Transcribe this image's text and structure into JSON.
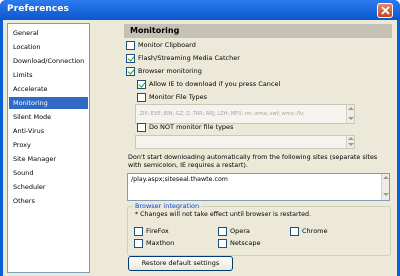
{
  "window": {
    "title": "Preferences"
  },
  "sidebar": {
    "items": [
      {
        "label": "General"
      },
      {
        "label": "Location"
      },
      {
        "label": "Download/Connection"
      },
      {
        "label": "Limits"
      },
      {
        "label": "Accelerate"
      },
      {
        "label": "Monitoring",
        "selected": true
      },
      {
        "label": "Silent Mode"
      },
      {
        "label": "Anti-Virus"
      },
      {
        "label": "Proxy"
      },
      {
        "label": "Site Manager"
      },
      {
        "label": "Sound"
      },
      {
        "label": "Scheduler"
      },
      {
        "label": "Others"
      }
    ]
  },
  "panel": {
    "title": "Monitoring",
    "monitor_clipboard": {
      "label": "Monitor Clipboard",
      "checked": false
    },
    "flash_streaming": {
      "label": "Flash/Streaming Media Catcher",
      "checked": true
    },
    "browser_monitoring": {
      "label": "Browser monitoring",
      "checked": true
    },
    "allow_ie": {
      "label": "Allow IE to download if you press Cancel",
      "checked": true
    },
    "monitor_file_types": {
      "label": "Monitor File Types",
      "checked": false
    },
    "file_types_value": ".ZIP;.EXE;.BIN;.GZ;.Z;.TAR;.ARJ;.LZH;.MP3;.rm;.wma;.swf;.wmv;.flv;.",
    "do_not_monitor": {
      "label": "Do NOT monitor file types",
      "checked": false
    },
    "sites_info": "Don't start downloading automatically from the following sites (separate sites with semicolon, IE requires a restart).",
    "sites_value": "/play.aspx;siteseal.thawte.com",
    "browser_integration": {
      "legend": "Browser integration",
      "note": "* Changes will not take effect until browser is restarted.",
      "browsers": [
        {
          "label": "FireFox",
          "checked": false
        },
        {
          "label": "Opera",
          "checked": false
        },
        {
          "label": "Chrome",
          "checked": false
        },
        {
          "label": "Maxthon",
          "checked": false
        },
        {
          "label": "Netscape",
          "checked": false
        }
      ]
    },
    "restore_button": "Restore default settings"
  }
}
